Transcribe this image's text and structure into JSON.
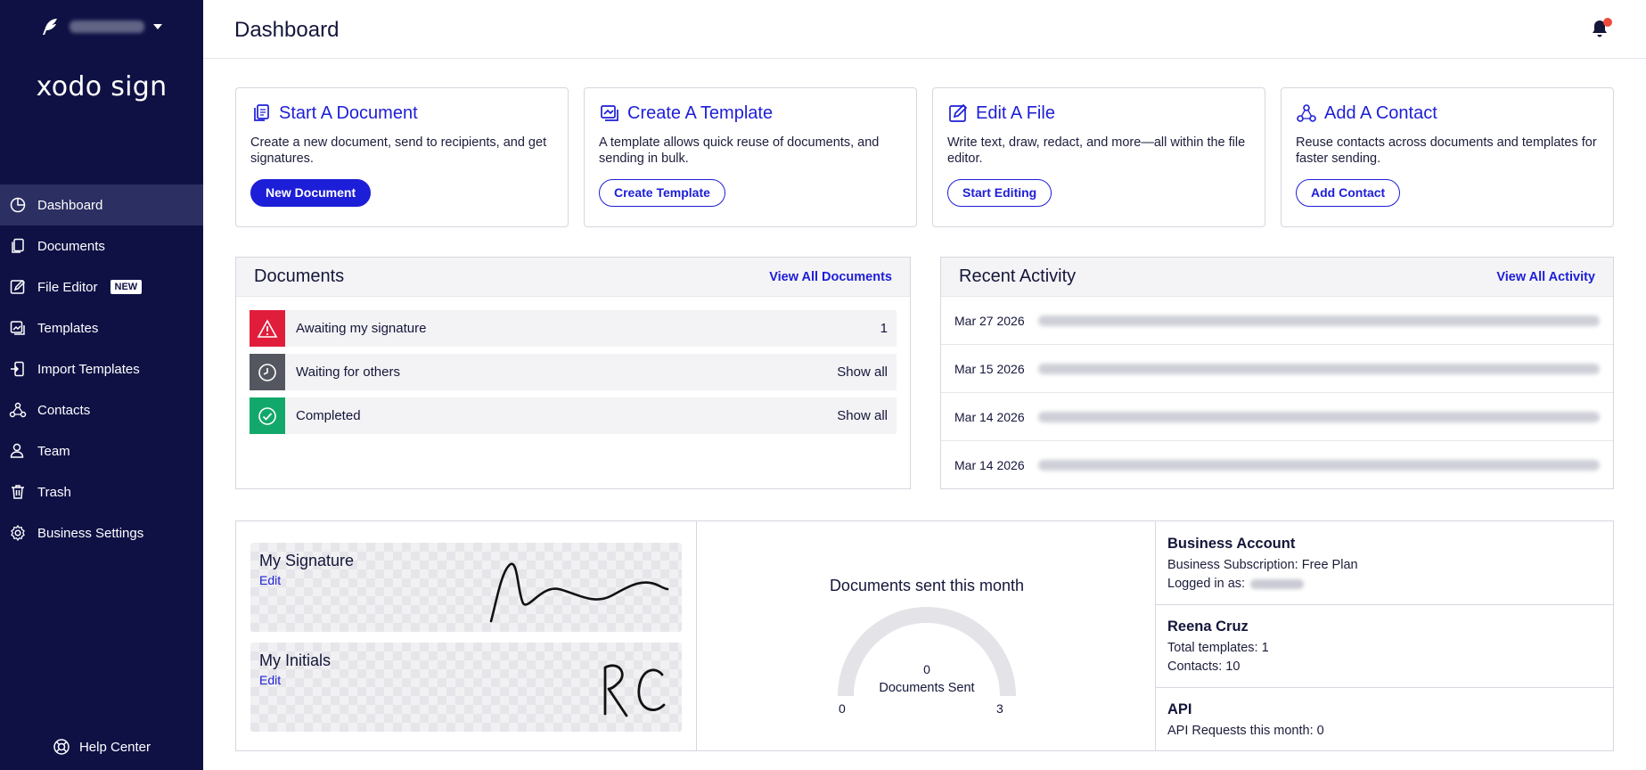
{
  "sidebar": {
    "brand": "xodo sign",
    "items": [
      {
        "label": "Dashboard",
        "icon": "pie-chart-icon",
        "active": true
      },
      {
        "label": "Documents",
        "icon": "documents-icon"
      },
      {
        "label": "File Editor",
        "icon": "edit-file-icon",
        "badge": "NEW"
      },
      {
        "label": "Templates",
        "icon": "templates-icon"
      },
      {
        "label": "Import Templates",
        "icon": "import-icon"
      },
      {
        "label": "Contacts",
        "icon": "contacts-icon"
      },
      {
        "label": "Team",
        "icon": "team-icon"
      },
      {
        "label": "Trash",
        "icon": "trash-icon"
      },
      {
        "label": "Business Settings",
        "icon": "gear-icon"
      }
    ],
    "help_label": "Help Center"
  },
  "header": {
    "title": "Dashboard"
  },
  "cards": [
    {
      "title": "Start A Document",
      "desc": "Create a new document, send to recipients, and get signatures.",
      "button": "New Document"
    },
    {
      "title": "Create A Template",
      "desc": "A template allows quick reuse of documents, and sending in bulk.",
      "button": "Create Template"
    },
    {
      "title": "Edit A File",
      "desc": "Write text, draw, redact, and more—all within the file editor.",
      "button": "Start Editing"
    },
    {
      "title": "Add A Contact",
      "desc": "Reuse contacts across documents and templates for faster sending.",
      "button": "Add Contact"
    }
  ],
  "documents": {
    "title": "Documents",
    "link": "View All Documents",
    "rows": [
      {
        "label": "Awaiting my signature",
        "value": "1",
        "color": "#e01e3c"
      },
      {
        "label": "Waiting for others",
        "value": "Show all",
        "color": "#54575f"
      },
      {
        "label": "Completed",
        "value": "Show all",
        "color": "#13a86b"
      }
    ]
  },
  "activity": {
    "title": "Recent Activity",
    "link": "View All Activity",
    "rows": [
      {
        "date": "Mar 27 2026"
      },
      {
        "date": "Mar 15 2026"
      },
      {
        "date": "Mar 14 2026"
      },
      {
        "date": "Mar 14 2026"
      }
    ]
  },
  "signature": {
    "title": "My Signature",
    "edit": "Edit"
  },
  "initials": {
    "title": "My Initials",
    "edit": "Edit"
  },
  "gauge": {
    "title": "Documents sent this month",
    "value": "0",
    "label": "Documents Sent",
    "min": "0",
    "max": "3"
  },
  "business": {
    "title": "Business Account",
    "subscription": "Business Subscription: Free Plan",
    "logged_in": "Logged in as:"
  },
  "user": {
    "name": "Reena Cruz",
    "templates": "Total templates: 1",
    "contacts": "Contacts: 10"
  },
  "api": {
    "title": "API",
    "requests": "API Requests this month: 0"
  },
  "colors": {
    "sidebar": "#0f1145",
    "accent": "#1d1ed7"
  }
}
